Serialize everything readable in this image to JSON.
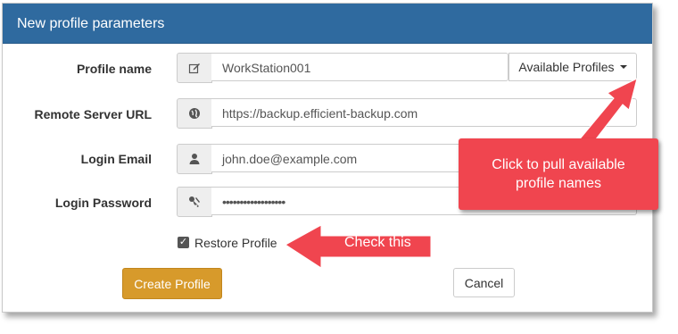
{
  "panel": {
    "title": "New profile parameters"
  },
  "fields": [
    {
      "label": "Profile name",
      "value": "WorkStation001",
      "icon": "pencil-icon"
    },
    {
      "label": "Remote Server URL",
      "value": "https://backup.efficient-backup.com",
      "icon": "globe-icon"
    },
    {
      "label": "Login Email",
      "value": "john.doe@example.com",
      "icon": "user-icon"
    },
    {
      "label": "Login Password",
      "value": "••••••••••••••••••",
      "icon": "key-icon"
    }
  ],
  "dropdown": {
    "label": "Available Profiles"
  },
  "restore": {
    "label": "Restore Profile",
    "checked": true
  },
  "buttons": {
    "create": "Create Profile",
    "cancel": "Cancel"
  },
  "callouts": {
    "dropdown_hint": "Click to pull available\nprofile names",
    "restore_hint": "Check this"
  },
  "colors": {
    "header": "#2f6a9f",
    "primary_button": "#d79a2b",
    "callout": "#f0454f"
  }
}
